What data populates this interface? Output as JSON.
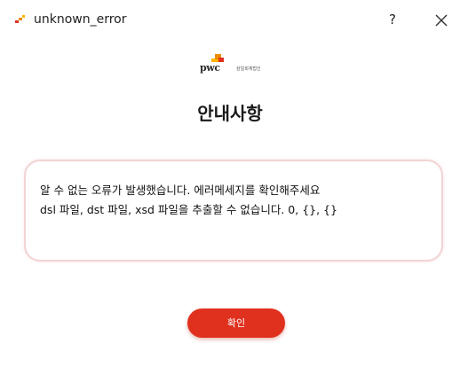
{
  "window": {
    "title": "unknown_error",
    "help_label": "?",
    "close_icon": "close-icon",
    "app_icon": "pwc-app-icon"
  },
  "logo": {
    "wordmark": "pwc",
    "subtext": "삼일회계법인",
    "colors": [
      "#e0301e",
      "#eb8c00",
      "#ffb600"
    ]
  },
  "heading": "안내사항",
  "message": {
    "lines": [
      "알 수 없는 오류가 발생했습니다. 에러메세지를 확인해주세요",
      "dsl 파일, dst 파일, xsd 파일을 추출할 수 없습니다. 0, {}, {}"
    ]
  },
  "confirm_button": {
    "label": "확인",
    "color": "#e0301e"
  }
}
